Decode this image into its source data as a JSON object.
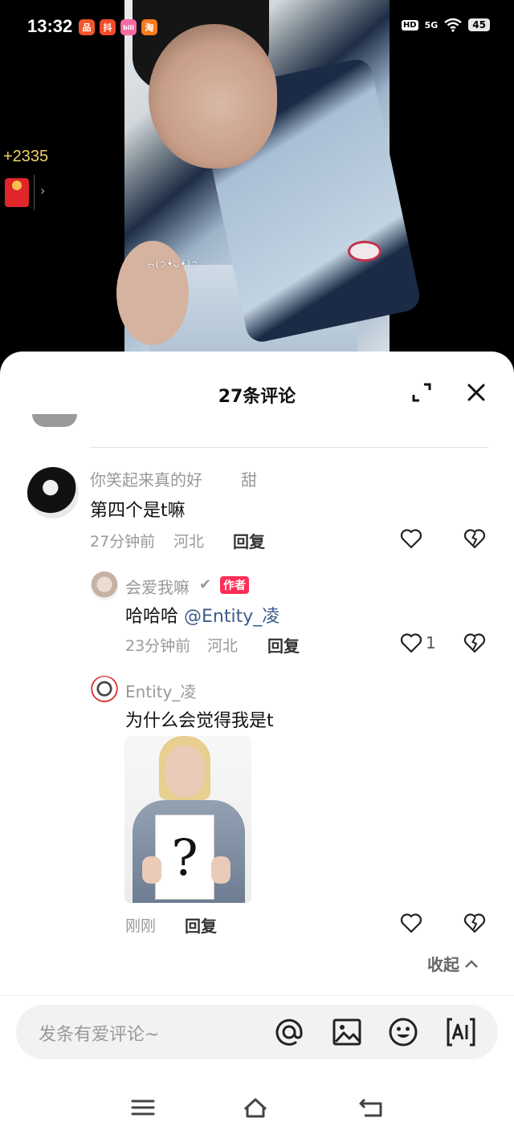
{
  "status_bar": {
    "time": "13:32",
    "apps": [
      {
        "name": "app-icon-1",
        "glyph": "品",
        "color": "#f0562a"
      },
      {
        "name": "app-icon-2",
        "glyph": "抖",
        "color": "#f44a2a"
      },
      {
        "name": "app-icon-3",
        "glyph": "bili",
        "color": "#f46ba0"
      },
      {
        "name": "app-icon-4",
        "glyph": "淘",
        "color": "#f97a1c"
      }
    ],
    "hd": "HD",
    "network": "5G",
    "battery": "45"
  },
  "video": {
    "reward_amount": "+2335",
    "caption_glyphs": "⌒(੭•̀ᴗ•́)੭"
  },
  "sheet": {
    "title": "27条评论"
  },
  "comments": [
    {
      "username": "你笑起来真的好",
      "username_suffix": "甜",
      "text": "第四个是t嘛",
      "time": "27分钟前",
      "location": "河北",
      "reply_label": "回复",
      "like_count": ""
    }
  ],
  "replies": [
    {
      "username": "会爱我嘛",
      "verified_mark": "✔",
      "author_tag": "作者",
      "text": "哈哈哈",
      "mention": "@Entity_凌",
      "time": "23分钟前",
      "location": "河北",
      "reply_label": "回复",
      "like_count": "1"
    },
    {
      "username": "Entity_凌",
      "text": "为什么会觉得我是t",
      "image_glyph": "?",
      "time": "刚刚",
      "reply_label": "回复",
      "like_count": ""
    }
  ],
  "collapse_label": "收起",
  "input": {
    "placeholder": "发条有爱评论~"
  },
  "icons": {
    "expand": "expand-icon",
    "close": "close-icon",
    "like": "heart-icon",
    "dislike": "broken-heart-icon",
    "at": "at-icon",
    "image": "image-icon",
    "emoji": "emoji-icon",
    "ai": "ai-icon"
  },
  "colors": {
    "author_tag": "#fe2c55",
    "mention": "#3b5b8a",
    "reward": "#f2d06b"
  }
}
